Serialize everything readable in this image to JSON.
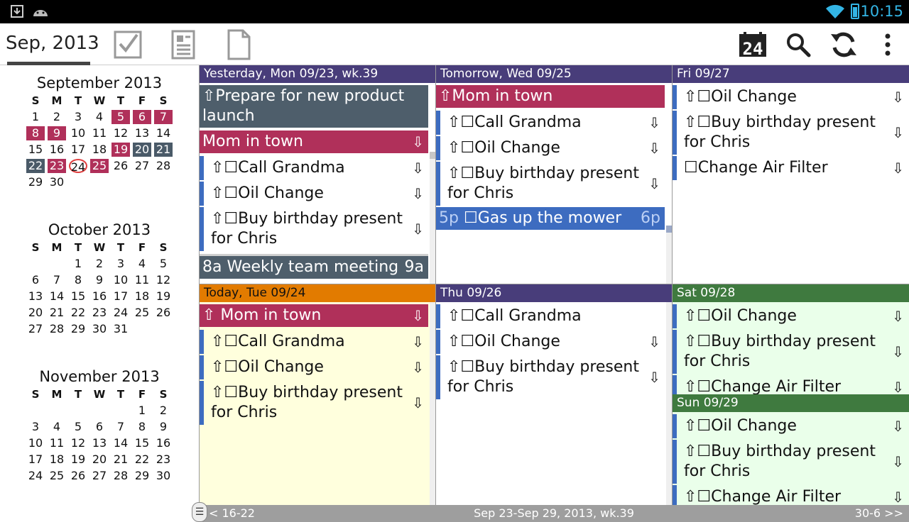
{
  "status": {
    "time": "10:15"
  },
  "actionbar": {
    "title": "Sep, 2013",
    "date_badge": "24"
  },
  "colors": {
    "header_purple": "#483d7a",
    "header_today": "#e27b00",
    "header_green": "#3f7a3f",
    "event_red": "#b0305a",
    "event_slate": "#4e5e6b",
    "event_blue": "#3d6cc0",
    "task_bar": "#3d6cc0",
    "today_bg": "#ffffdd",
    "weekend_bg": "#eaffea"
  },
  "months": [
    {
      "title": "September 2013",
      "dows": [
        "S",
        "M",
        "T",
        "W",
        "T",
        "F",
        "S"
      ],
      "weeks": [
        [
          "1",
          "2",
          "3",
          "4",
          "5",
          "6",
          "7"
        ],
        [
          "8",
          "9",
          "10",
          "11",
          "12",
          "13",
          "14"
        ],
        [
          "15",
          "16",
          "17",
          "18",
          "19",
          "20",
          "21"
        ],
        [
          "22",
          "23",
          "24",
          "25",
          "26",
          "27",
          "28"
        ],
        [
          "29",
          "30",
          "",
          "",
          "",
          "",
          ""
        ]
      ]
    },
    {
      "title": "October 2013",
      "dows": [
        "S",
        "M",
        "T",
        "W",
        "T",
        "F",
        "S"
      ],
      "weeks": [
        [
          "",
          "",
          "1",
          "2",
          "3",
          "4",
          "5"
        ],
        [
          "6",
          "7",
          "8",
          "9",
          "10",
          "11",
          "12"
        ],
        [
          "13",
          "14",
          "15",
          "16",
          "17",
          "18",
          "19"
        ],
        [
          "20",
          "21",
          "22",
          "23",
          "24",
          "25",
          "26"
        ],
        [
          "27",
          "28",
          "29",
          "30",
          "31",
          "",
          ""
        ]
      ]
    },
    {
      "title": "November 2013",
      "dows": [
        "S",
        "M",
        "T",
        "W",
        "T",
        "F",
        "S"
      ],
      "weeks": [
        [
          "",
          "",
          "",
          "",
          "",
          "1",
          "2"
        ],
        [
          "3",
          "4",
          "5",
          "6",
          "7",
          "8",
          "9"
        ],
        [
          "10",
          "11",
          "12",
          "13",
          "14",
          "15",
          "16"
        ],
        [
          "17",
          "18",
          "19",
          "20",
          "21",
          "22",
          "23"
        ],
        [
          "24",
          "25",
          "26",
          "27",
          "28",
          "29",
          "30"
        ]
      ]
    }
  ],
  "days": {
    "yesterday": {
      "header": "Yesterday, Mon 09/23, wk.39",
      "e1": "⇧Prepare for new product launch",
      "e2": "Mom in town",
      "e3": "⇧☐Call Grandma",
      "e4": "⇧☐Oil Change",
      "e5": "⇧☐Buy birthday present for Chris",
      "e6_time": "8a",
      "e6": "Weekly team meeting",
      "e6_end": "9a"
    },
    "tomorrow": {
      "header": "Tomorrow, Wed 09/25",
      "e1": "⇧Mom in town",
      "e2": "⇧☐Call Grandma",
      "e3": "⇧☐Oil Change",
      "e4": "⇧☐Buy birthday present for Chris",
      "e5_time": "5p",
      "e5": "☐Gas up the mower",
      "e5_end": "6p"
    },
    "fri": {
      "header": "Fri 09/27",
      "e1": "⇧☐Oil Change",
      "e2": "⇧☐Buy birthday present for Chris",
      "e3": "☐Change Air Filter"
    },
    "today": {
      "header": "Today, Tue 09/24",
      "e1": "⇧ Mom in town",
      "e2": "⇧☐Call Grandma",
      "e3": "⇧☐Oil Change",
      "e4": "⇧☐Buy birthday present for Chris"
    },
    "thu": {
      "header": "Thu 09/26",
      "e1": "⇧☐Call Grandma",
      "e2": "⇧☐Oil Change",
      "e3": "⇧☐Buy birthday present for Chris"
    },
    "sat": {
      "header": "Sat 09/28",
      "e1": "⇧☐Oil Change",
      "e2": "⇧☐Buy birthday present for Chris",
      "e3": "⇧☐Change Air Filter"
    },
    "sun": {
      "header": "Sun 09/29",
      "e1": "⇧☐Oil Change",
      "e2": "⇧☐Buy birthday present for Chris",
      "e3": "⇧☐Change Air Filter"
    }
  },
  "arrow": "⇩",
  "bottombar": {
    "prev": "< 16-22",
    "range": "Sep 23-Sep 29, 2013, wk.39",
    "next": "30-6 >>"
  },
  "drawer_handle": "☰"
}
